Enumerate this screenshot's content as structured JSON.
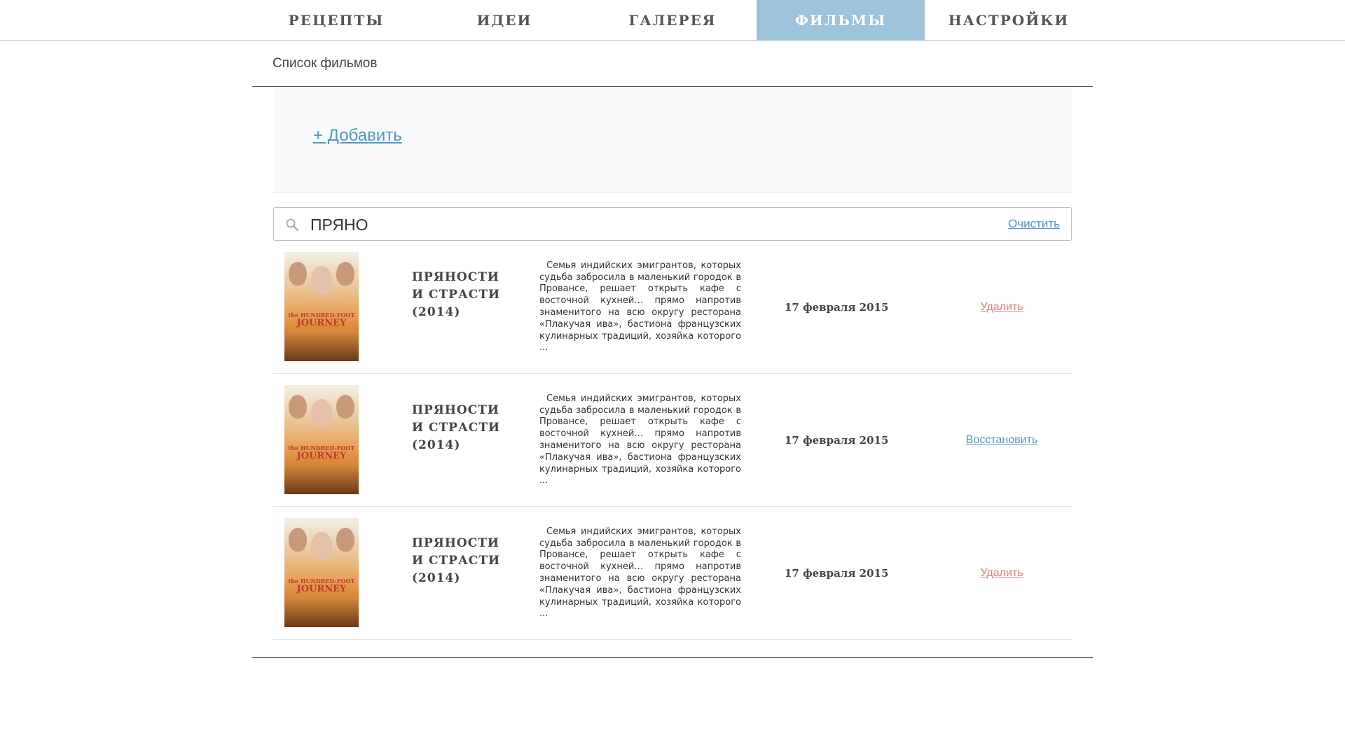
{
  "nav": {
    "tabs": [
      {
        "label": "РЕЦЕПТЫ",
        "active": false
      },
      {
        "label": "ИДЕИ",
        "active": false
      },
      {
        "label": "ГАЛЕРЕЯ",
        "active": false
      },
      {
        "label": "ФИЛЬМЫ",
        "active": true
      },
      {
        "label": "НАСТРОЙКИ",
        "active": false
      }
    ],
    "active_color": "#9dc3da"
  },
  "page": {
    "title": "Список фильмов"
  },
  "add": {
    "label": "+ Добавить"
  },
  "search": {
    "value": "ПРЯНО",
    "clear_label": "Очистить",
    "icon": "search-icon"
  },
  "movies": [
    {
      "poster_icon": "poster-image",
      "poster_title_small": "the HUNDRED-FOOT",
      "poster_title": "JOURNEY",
      "title": "ПРЯНОСТИ\nИ СТРАСТИ\n(2014)",
      "description": "Семья индийских эмигрантов, которых судьба забросила в маленький городок в Провансе, решает открыть кафе с восточной кухней… прямо напротив знаменитого на всю округу ресторана «Плакучая ива», бастиона французских кулинарных традиций, хозяйка которого ...",
      "date": "17 февраля 2015",
      "action": "Удалить",
      "action_type": "delete"
    },
    {
      "poster_icon": "poster-image",
      "poster_title_small": "the HUNDRED-FOOT",
      "poster_title": "JOURNEY",
      "title": "ПРЯНОСТИ\nИ СТРАСТИ\n(2014)",
      "description": "Семья индийских эмигрантов, которых судьба забросила в маленький городок в Провансе, решает открыть кафе с восточной кухней… прямо напротив знаменитого на всю округу ресторана «Плакучая ива», бастиона французских кулинарных традиций, хозяйка которого ...",
      "date": "17 февраля 2015",
      "action": "Восстановить",
      "action_type": "restore"
    },
    {
      "poster_icon": "poster-image",
      "poster_title_small": "the HUNDRED-FOOT",
      "poster_title": "JOURNEY",
      "title": "ПРЯНОСТИ\nИ СТРАСТИ\n(2014)",
      "description": "Семья индийских эмигрантов, которых судьба забросила в маленький городок в Провансе, решает открыть кафе с восточной кухней… прямо напротив знаменитого на всю округу ресторана «Плакучая ива», бастиона французских кулинарных традиций, хозяйка которого ...",
      "date": "17 февраля 2015",
      "action": "Удалить",
      "action_type": "delete"
    }
  ],
  "colors": {
    "link": "#5398c0",
    "delete": "#e87a7a"
  }
}
